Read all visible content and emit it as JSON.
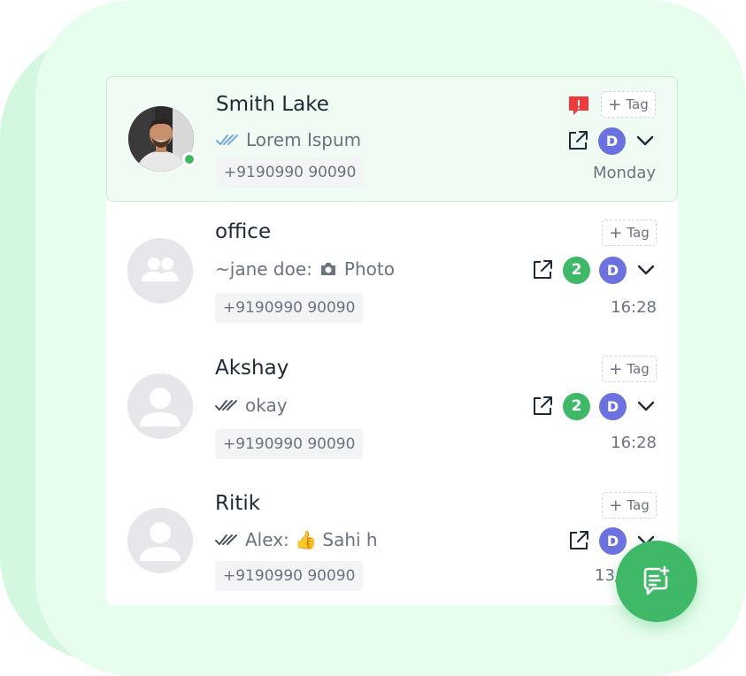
{
  "chats": [
    {
      "name": "Smith Lake",
      "preview": "Lorem Ispum",
      "phone": "+9190990 90090",
      "tag_label": "Tag",
      "assignee_initial": "D",
      "time": "Monday",
      "avatar": "person-photo",
      "online": true,
      "alert_icon": "alert-icon"
    },
    {
      "name": "office",
      "preview_sender": "~jane doe:",
      "preview": "Photo",
      "preview_icon": "camera-icon",
      "phone": "+9190990 90090",
      "tag_label": "Tag",
      "unread_count": "2",
      "assignee_initial": "D",
      "time": "16:28",
      "avatar": "group-icon"
    },
    {
      "name": "Akshay",
      "preview": "okay",
      "phone": "+9190990 90090",
      "tag_label": "Tag",
      "unread_count": "2",
      "assignee_initial": "D",
      "time": "16:28",
      "avatar": "user-icon"
    },
    {
      "name": "Ritik",
      "preview": "Alex: 👍 Sahi h",
      "phone": "+9190990 90090",
      "tag_label": "Tag",
      "assignee_initial": "D",
      "time": "13/",
      "avatar": "user-icon"
    }
  ],
  "fab": {
    "icon": "new-chat-icon"
  },
  "colors": {
    "accent_green": "#3fb867",
    "assignee_purple": "#6b72e0",
    "alert_red": "#ef3b3b",
    "read_tick_blue": "#7aa7e8",
    "background_mint": "#e7fdee"
  }
}
